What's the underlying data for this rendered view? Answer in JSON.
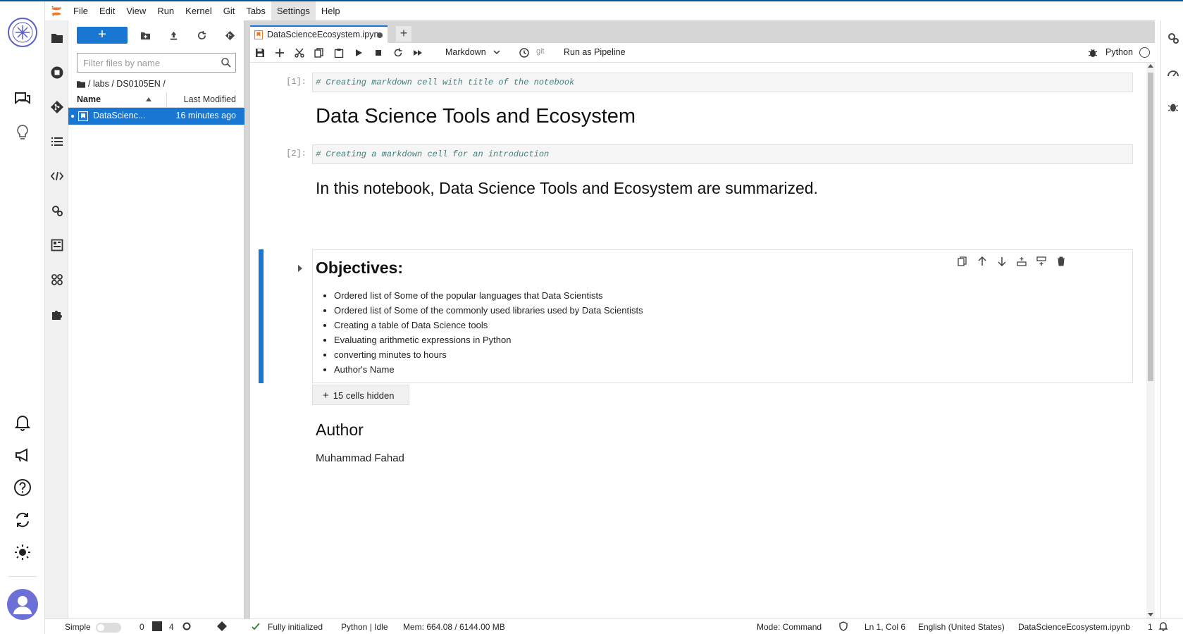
{
  "menubar": {
    "items": [
      "File",
      "Edit",
      "View",
      "Run",
      "Kernel",
      "Git",
      "Tabs",
      "Settings",
      "Help"
    ],
    "active": "Settings"
  },
  "filebrowser": {
    "new_label": "+",
    "filter_placeholder": "Filter files by name",
    "breadcrumb": "/ labs / DS0105EN /",
    "col_name": "Name",
    "col_modified": "Last Modified",
    "files": [
      {
        "name": "DataScienc...",
        "modified": "16 minutes ago",
        "selected": true
      }
    ]
  },
  "tab": {
    "label": "DataScienceEcosystem.ipyn",
    "add": "+"
  },
  "toolbar": {
    "cell_type": "Markdown",
    "git": "git",
    "pipeline": "Run as Pipeline",
    "kernel": "Python"
  },
  "notebook": {
    "cell1_prompt": "[1]:",
    "cell1_code": "# Creating markdown cell with title of the notebook",
    "title": "Data Science Tools and Ecosystem",
    "cell2_prompt": "[2]:",
    "cell2_code": "# Creating a markdown cell for an introduction",
    "intro": "In this notebook, Data Science Tools and Ecosystem are summarized.",
    "objectives_heading": "Objectives:",
    "objectives": [
      "Ordered list of Some of the popular languages that Data Scientists",
      "Ordered list of Some of the commonly used libraries used by Data Scientists",
      "Creating a table of Data Science tools",
      "Evaluating arithmetic expressions in Python",
      "converting minutes to hours",
      "Author's Name"
    ],
    "hidden_cells": "15 cells hidden",
    "author_heading": "Author",
    "author_name": "Muhammad Fahad"
  },
  "statusbar": {
    "mode_label": "Simple",
    "terminals": "0",
    "kernels": "4",
    "init": "Fully initialized",
    "kernel_status": "Python | Idle",
    "mem": "Mem: 664.08 / 6144.00 MB",
    "mode": "Mode: Command",
    "cursor": "Ln 1, Col 6",
    "language": "English (United States)",
    "filename": "DataScienceEcosystem.ipynb",
    "notifications": "1"
  },
  "colors": {
    "accent": "#1976d2",
    "topline": "#0b5394"
  }
}
